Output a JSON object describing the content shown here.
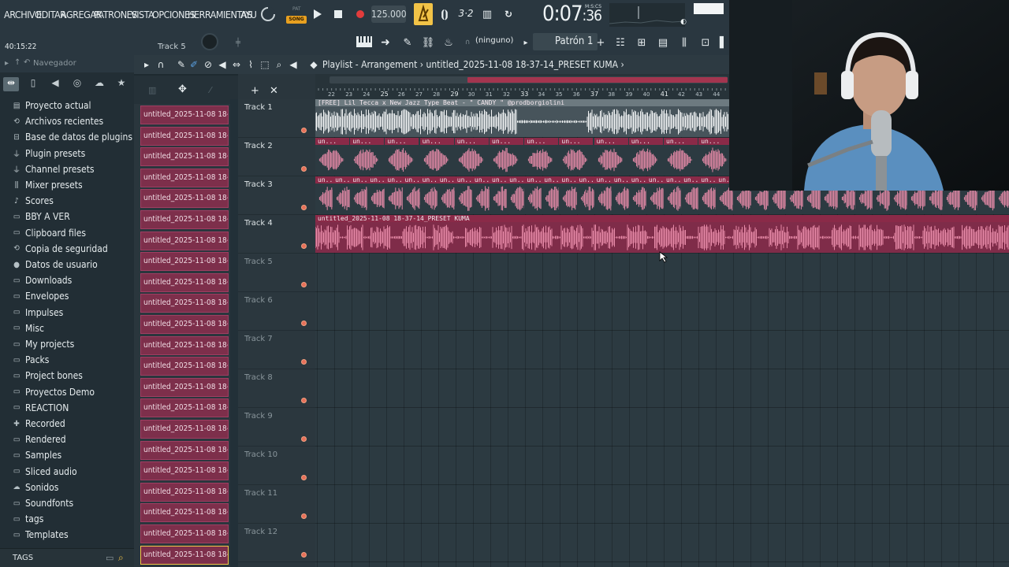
{
  "menu": [
    "ARCHIVO",
    "EDITAR",
    "AGREGAR",
    "PATRONES",
    "VISTA",
    "OPCIONES",
    "HERRAMIENTAS",
    "AYU"
  ],
  "transport": {
    "pat_label": "PAT",
    "song_label": "SONG",
    "tempo": "125.000",
    "time_main": "0:07",
    "time_sub": ":36",
    "time_unit": "M:S:CS"
  },
  "toolbar2": {
    "time_left": "40:15:22",
    "track_sel": "Track 5",
    "snap": "(ninguno)",
    "pattern": "Patrón 1"
  },
  "browser": {
    "title": "Navegador",
    "items": [
      {
        "label": "Proyecto actual",
        "icon": "project-icon"
      },
      {
        "label": "Archivos recientes",
        "icon": "recent-icon"
      },
      {
        "label": "Base de datos de plugins",
        "icon": "plugin-db-icon"
      },
      {
        "label": "Plugin presets",
        "icon": "plug-icon"
      },
      {
        "label": "Channel presets",
        "icon": "plug-icon"
      },
      {
        "label": "Mixer presets",
        "icon": "mixer-icon"
      },
      {
        "label": "Scores",
        "icon": "note-icon"
      },
      {
        "label": "BBY A VER",
        "icon": "folder-icon"
      },
      {
        "label": "Clipboard files",
        "icon": "folder-icon"
      },
      {
        "label": "Copia de seguridad",
        "icon": "backup-icon"
      },
      {
        "label": "Datos de usuario",
        "icon": "user-icon"
      },
      {
        "label": "Downloads",
        "icon": "folder-icon"
      },
      {
        "label": "Envelopes",
        "icon": "folder-icon"
      },
      {
        "label": "Impulses",
        "icon": "folder-icon"
      },
      {
        "label": "Misc",
        "icon": "folder-icon"
      },
      {
        "label": "My projects",
        "icon": "folder-icon"
      },
      {
        "label": "Packs",
        "icon": "folder-icon"
      },
      {
        "label": "Project bones",
        "icon": "folder-icon"
      },
      {
        "label": "Proyectos Demo",
        "icon": "folder-icon"
      },
      {
        "label": "REACTION",
        "icon": "folder-icon"
      },
      {
        "label": "Recorded",
        "icon": "recorded-icon"
      },
      {
        "label": "Rendered",
        "icon": "folder-icon"
      },
      {
        "label": "Samples",
        "icon": "folder-icon"
      },
      {
        "label": "Sliced audio",
        "icon": "folder-icon"
      },
      {
        "label": "Sonidos",
        "icon": "cloud-icon"
      },
      {
        "label": "Soundfonts",
        "icon": "folder-icon"
      },
      {
        "label": "tags",
        "icon": "folder-icon"
      },
      {
        "label": "Templates",
        "icon": "folder-icon"
      }
    ],
    "footer_label": "TAGS"
  },
  "picker": {
    "clips": [
      "untitled_2025-11-08 18-...",
      "untitled_2025-11-08 18-...",
      "untitled_2025-11-08 18-...",
      "untitled_2025-11-08 18-...",
      "untitled_2025-11-08 18-...",
      "untitled_2025-11-08 18-...",
      "untitled_2025-11-08 18-...",
      "untitled_2025-11-08 18-...",
      "untitled_2025-11-08 18-...",
      "untitled_2025-11-08 18-...",
      "untitled_2025-11-08 18-...",
      "untitled_2025-11-08 18-...",
      "untitled_2025-11-08 18-...",
      "untitled_2025-11-08 18-...",
      "untitled_2025-11-08 18-...",
      "untitled_2025-11-08 18-...",
      "untitled_2025-11-08 18-...",
      "untitled_2025-11-08 18-...",
      "untitled_2025-11-08 18-...",
      "untitled_2025-11-08 18-...",
      "untitled_2025-11-08 18-...",
      "untitled_2025-11-08 18-..."
    ]
  },
  "playlist": {
    "title_prefix": "Playlist - Arrangement",
    "title_project": "untitled_2025-11-08 18-37-14_PRESET KUMA",
    "ruler": [
      "22",
      "23",
      "24",
      "25",
      "26",
      "27",
      "28",
      "29",
      "30",
      "31",
      "32",
      "33",
      "34",
      "35",
      "36",
      "37",
      "38",
      "39",
      "40",
      "41",
      "42",
      "43",
      "44"
    ],
    "tracks": [
      "Track 1",
      "Track 2",
      "Track 3",
      "Track 4",
      "Track 5",
      "Track 6",
      "Track 7",
      "Track 8",
      "Track 9",
      "Track 10",
      "Track 11",
      "Track 12"
    ],
    "track1_clip": "[FREE] Lil Tecca x New Jazz Type Beat - \" CANDY \" @prodborgiolini",
    "track2_clip": "un...",
    "track3_clip": "un...",
    "track4_clip": "untitled_2025-11-08 18-37-14_PRESET KUMA"
  },
  "colors": {
    "clip": "#a3355a",
    "clip_hdr": "#8a2a48",
    "wave": "#e78aa8",
    "accent": "#f2c347"
  }
}
